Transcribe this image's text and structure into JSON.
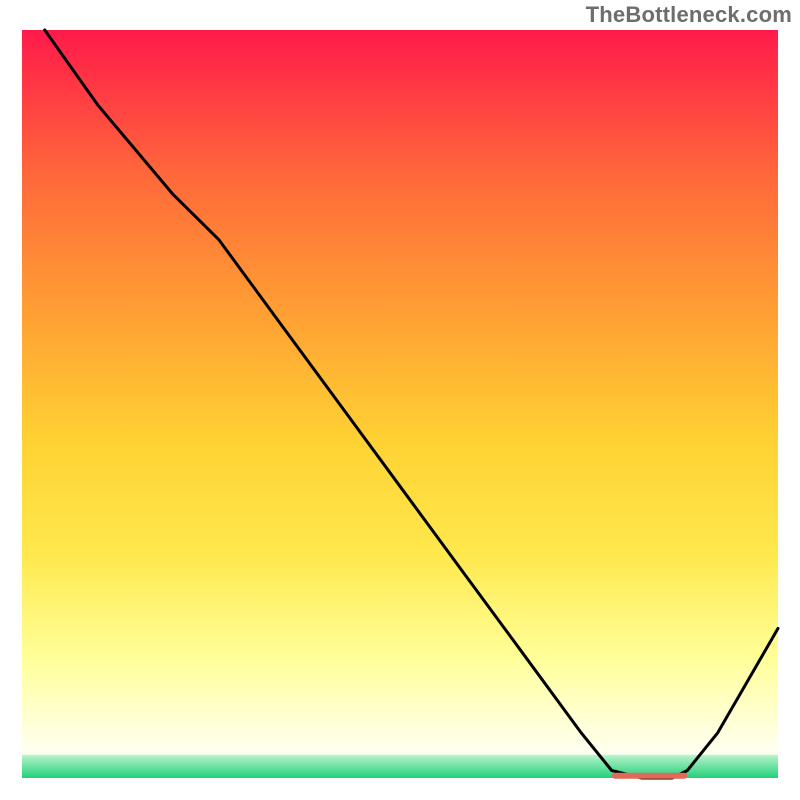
{
  "watermark": "TheBottleneck.com",
  "colors": {
    "top": "#ff1a4a",
    "mid_red_orange": "#ff6a3a",
    "mid_orange": "#ffa033",
    "mid_yellow": "#ffd233",
    "lower_yellow": "#ffe84d",
    "pale_yellow": "#ffff99",
    "near_bottom": "#ffffd2",
    "green": "#1fd17a",
    "curve": "#000000",
    "marker": "#e0695a"
  },
  "chart_data": {
    "type": "line",
    "title": "",
    "xlabel": "",
    "ylabel": "",
    "xlim": [
      0,
      100
    ],
    "ylim": [
      0,
      100
    ],
    "series": [
      {
        "name": "bottleneck-curve",
        "x": [
          3,
          10,
          20,
          26,
          34,
          42,
          50,
          58,
          66,
          74,
          78,
          82,
          86,
          88,
          92,
          96,
          100
        ],
        "y": [
          100,
          90,
          78,
          72,
          61,
          50,
          39,
          28,
          17,
          6,
          1,
          0,
          0,
          1,
          6,
          13,
          20
        ]
      }
    ],
    "marker": {
      "name": "optimal-band",
      "x_start": 78,
      "x_end": 88,
      "y": 0.3
    }
  }
}
